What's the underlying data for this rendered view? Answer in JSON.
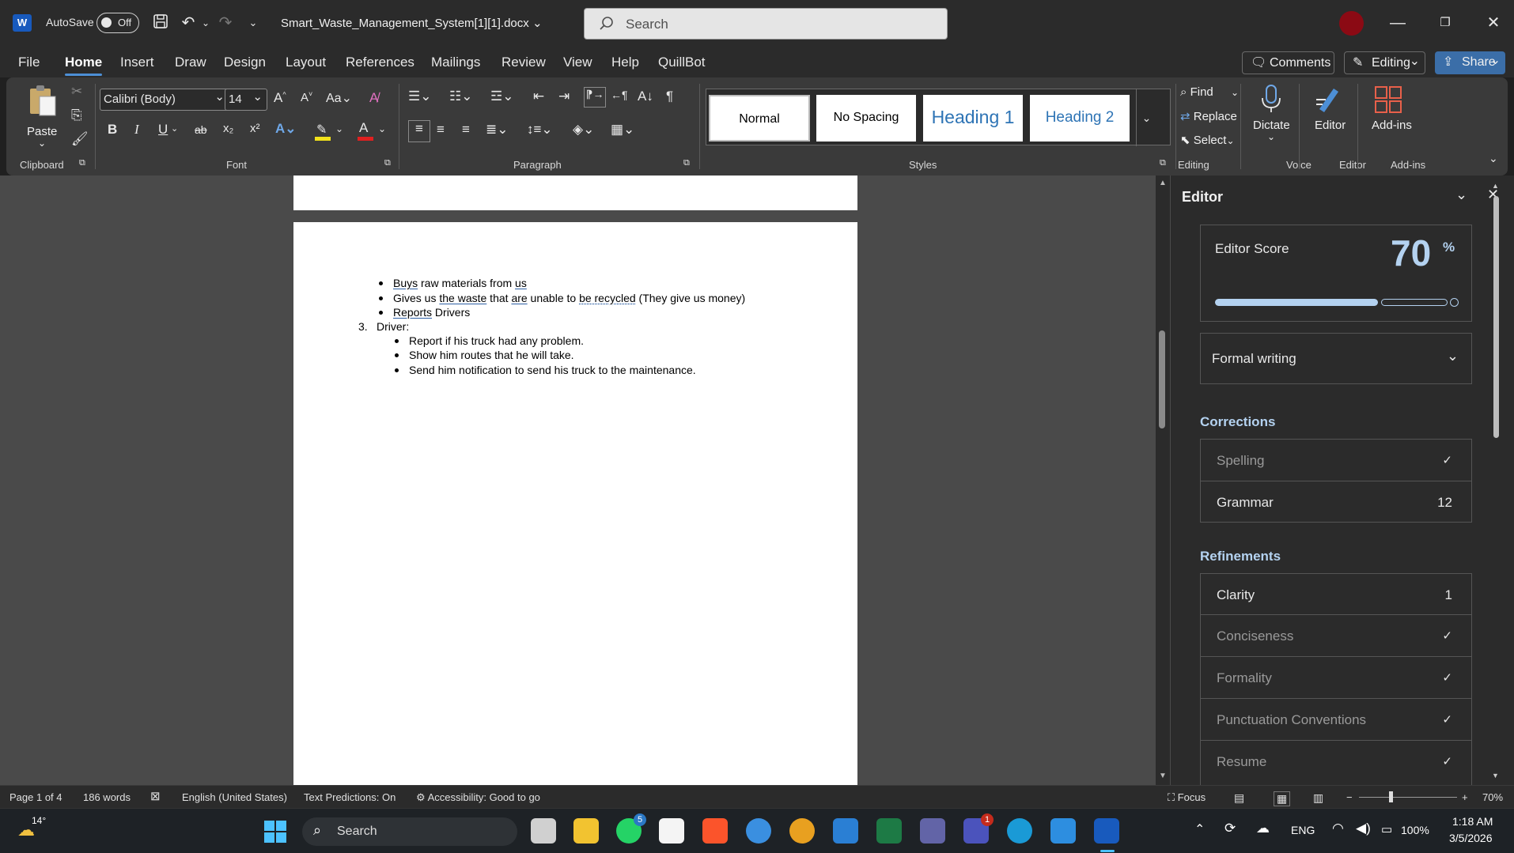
{
  "titlebar": {
    "app_logo": "W",
    "autosave_label": "AutoSave",
    "autosave_state": "Off",
    "filename": "Smart_Waste_Management_System[1][1].docx",
    "search_placeholder": "Search"
  },
  "menu": {
    "items": [
      "File",
      "Home",
      "Insert",
      "Draw",
      "Design",
      "Layout",
      "References",
      "Mailings",
      "Review",
      "View",
      "Help",
      "QuillBot"
    ],
    "active": "Home",
    "comments_label": "Comments",
    "editing_label": "Editing",
    "share_label": "Share"
  },
  "ribbon": {
    "clipboard": {
      "paste_label": "Paste",
      "group_label": "Clipboard"
    },
    "font": {
      "font_name": "Calibri (Body)",
      "font_size": "14",
      "group_label": "Font",
      "bold": "B",
      "italic": "I",
      "underline": "U",
      "strike": "ab",
      "subscript": "x₂",
      "superscript": "x²"
    },
    "paragraph": {
      "group_label": "Paragraph"
    },
    "styles": {
      "group_label": "Styles",
      "items": [
        "Normal",
        "No Spacing",
        "Heading 1",
        "Heading 2"
      ]
    },
    "editing": {
      "group_label": "Editing",
      "find": "Find",
      "replace": "Replace",
      "select": "Select"
    },
    "voice": {
      "group_label": "Voice",
      "dictate": "Dictate"
    },
    "editor_grp": {
      "group_label": "Editor",
      "editor": "Editor"
    },
    "addins": {
      "group_label": "Add-ins",
      "addins": "Add-ins"
    }
  },
  "document": {
    "bullets_a": [
      {
        "parts": [
          {
            "t": "Buys",
            "u": "solid"
          },
          {
            "t": " raw materials from "
          },
          {
            "t": "us",
            "u": "solid"
          }
        ]
      },
      {
        "parts": [
          {
            "t": "Gives us "
          },
          {
            "t": "the waste",
            "u": "solid"
          },
          {
            "t": " that "
          },
          {
            "t": "are",
            "u": "solid"
          },
          {
            "t": " unable to "
          },
          {
            "t": "be recycled",
            "u": "dotted"
          },
          {
            "t": " (They give us money)"
          }
        ]
      },
      {
        "parts": [
          {
            "t": "Reports",
            "u": "solid"
          },
          {
            "t": " Drivers"
          }
        ]
      }
    ],
    "numbered_item_number": "3.",
    "numbered_item_text": "Driver:",
    "bullets_b": [
      "Report if his truck had any problem.",
      "Show him routes that he will take.",
      "Send him notification to send his truck to the maintenance."
    ]
  },
  "editor_pane": {
    "title": "Editor",
    "score_label": "Editor Score",
    "score_value": "70",
    "score_unit": "%",
    "score_fraction": 0.7,
    "mode": "Formal writing",
    "corrections_label": "Corrections",
    "corrections": [
      {
        "label": "Spelling",
        "value": "✓",
        "done": true
      },
      {
        "label": "Grammar",
        "value": "12",
        "done": false
      }
    ],
    "refinements_label": "Refinements",
    "refinements": [
      {
        "label": "Clarity",
        "value": "1",
        "done": false
      },
      {
        "label": "Conciseness",
        "value": "✓",
        "done": true
      },
      {
        "label": "Formality",
        "value": "✓",
        "done": true
      },
      {
        "label": "Punctuation Conventions",
        "value": "✓",
        "done": true
      },
      {
        "label": "Resume",
        "value": "✓",
        "done": true
      }
    ]
  },
  "statusbar": {
    "page": "Page 1 of 4",
    "words": "186 words",
    "language": "English (United States)",
    "predictions": "Text Predictions: On",
    "accessibility": "Accessibility: Good to go",
    "focus": "Focus",
    "zoom": "70%"
  },
  "taskbar": {
    "weather": "14°",
    "search": "Search",
    "whatsapp_badge": "5",
    "teams_badge": "1",
    "lang": "ENG",
    "battery": "100%",
    "time": "1:18 AM",
    "date": "3/5/2026"
  },
  "colors": {
    "accent": "#4d8fd6",
    "heading_blue": "#2e74b5",
    "word_blue": "#185abd"
  }
}
